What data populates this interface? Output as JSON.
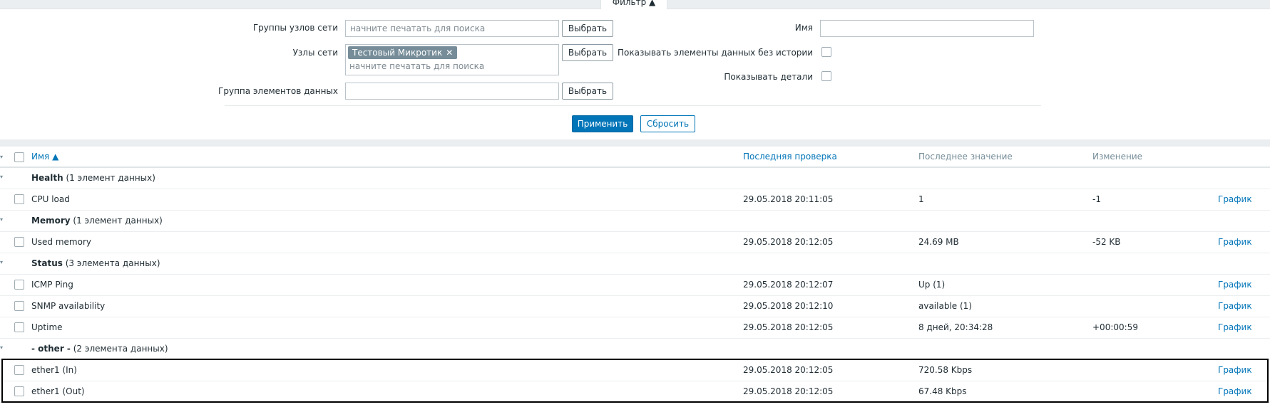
{
  "filter": {
    "tab_label": "Фильтр ▲",
    "host_groups_label": "Группы узлов сети",
    "host_groups_placeholder": "начните печатать для поиска",
    "hosts_label": "Узлы сети",
    "hosts_selected_tag": "Тестовый Микротик",
    "hosts_placeholder": "начните печатать для поиска",
    "item_group_label": "Группа элементов данных",
    "select_label": "Выбрать",
    "name_label": "Имя",
    "name_value": "",
    "show_without_history_label": "Показывать элементы данных без истории",
    "show_details_label": "Показывать детали",
    "apply_label": "Применить",
    "reset_label": "Сбросить"
  },
  "table": {
    "headers": {
      "name": "Имя ▲",
      "last_check": "Последняя проверка",
      "last_value": "Последнее значение",
      "change": "Изменение"
    },
    "graph_label": "График",
    "groups": [
      {
        "name": "Health",
        "count": " (1 элемент данных)"
      },
      {
        "name": "Memory",
        "count": " (1 элемент данных)"
      },
      {
        "name": "Status",
        "count": " (3 элемента данных)"
      },
      {
        "name": "- other -",
        "count": " (2 элемента данных)"
      }
    ],
    "items": [
      {
        "name": "CPU load",
        "last_check": "29.05.2018 20:11:05",
        "last_value": "1",
        "change": "-1"
      },
      {
        "name": "Used memory",
        "last_check": "29.05.2018 20:12:05",
        "last_value": "24.69 MB",
        "change": "-52 KB"
      },
      {
        "name": "ICMP Ping",
        "last_check": "29.05.2018 20:12:07",
        "last_value": "Up (1)",
        "change": ""
      },
      {
        "name": "SNMP availability",
        "last_check": "29.05.2018 20:12:10",
        "last_value": "available (1)",
        "change": ""
      },
      {
        "name": "Uptime",
        "last_check": "29.05.2018 20:12:05",
        "last_value": "8 дней, 20:34:28",
        "change": "+00:00:59"
      },
      {
        "name": "ether1 (In)",
        "last_check": "29.05.2018 20:12:05",
        "last_value": "720.58 Kbps",
        "change": ""
      },
      {
        "name": "ether1 (Out)",
        "last_check": "29.05.2018 20:12:05",
        "last_value": "67.48 Kbps",
        "change": ""
      }
    ]
  },
  "colors": {
    "accent": "#0275b8",
    "background_strip": "#ebeef0",
    "tag_bg": "#768d99"
  }
}
